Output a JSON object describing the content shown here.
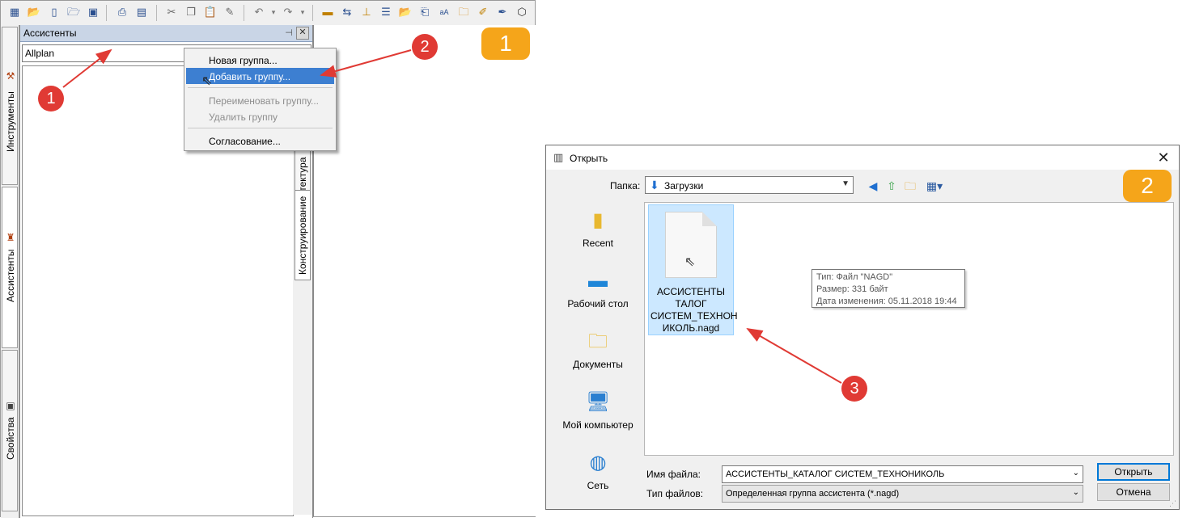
{
  "allplan": {
    "toolbar_icons": [
      "open-project-icon",
      "open-file-icon",
      "new-file-icon",
      "open-folder-icon",
      "save-icon",
      "print-preview-icon",
      "print-icon",
      "cut-icon",
      "copy-icon",
      "paste-icon",
      "format-painter-icon",
      "undo-icon",
      "redo-icon",
      "measure-icon",
      "dimension-icon",
      "level-icon",
      "list-icon",
      "open-icon",
      "export-icon",
      "text-icon",
      "folder-icon",
      "edit-icon",
      "3d-icon"
    ],
    "left_tabs": [
      "Инструменты",
      "Ассистенты",
      "Свойства"
    ],
    "panel_title": "Ассистенты",
    "combo_value": "Allplan",
    "right_tabs": [
      "Архитектура",
      "Конструирование"
    ],
    "context_menu": {
      "new_group": "Новая группа...",
      "add_group": "Добавить группу...",
      "rename_group": "Переименовать группу...",
      "delete_group": "Удалить группу",
      "agreement": "Согласование..."
    },
    "badge": "1",
    "markers": [
      "1",
      "2"
    ]
  },
  "dialog": {
    "title": "Открыть",
    "folder_label": "Папка:",
    "folder_value": "Загрузки",
    "badge": "2",
    "places": [
      "Recent",
      "Рабочий стол",
      "Документы",
      "Мой компьютер",
      "Сеть"
    ],
    "file_name_display": [
      "АССИСТЕНТЫ",
      "ТАЛОГ",
      "СИСТЕМ_ТЕХНОН",
      "ИКОЛЬ.nagd"
    ],
    "tooltip": {
      "type": "Тип: Файл \"NAGD\"",
      "size": "Размер: 331 байт",
      "modified": "Дата изменения: 05.11.2018 19:44"
    },
    "filename_label": "Имя файла:",
    "filename_value": "АССИСТЕНТЫ_КАТАЛОГ СИСТЕМ_ТЕХНОНИКОЛЬ",
    "filetype_label": "Тип файлов:",
    "filetype_value": "Определенная группа ассистента (*.nagd)",
    "open_button": "Открыть",
    "cancel_button": "Отмена",
    "marker": "3"
  },
  "colors": {
    "badge": "#f5a51a",
    "marker": "#e03a34",
    "highlight": "#3d7fd1",
    "selection": "#cce8ff"
  }
}
